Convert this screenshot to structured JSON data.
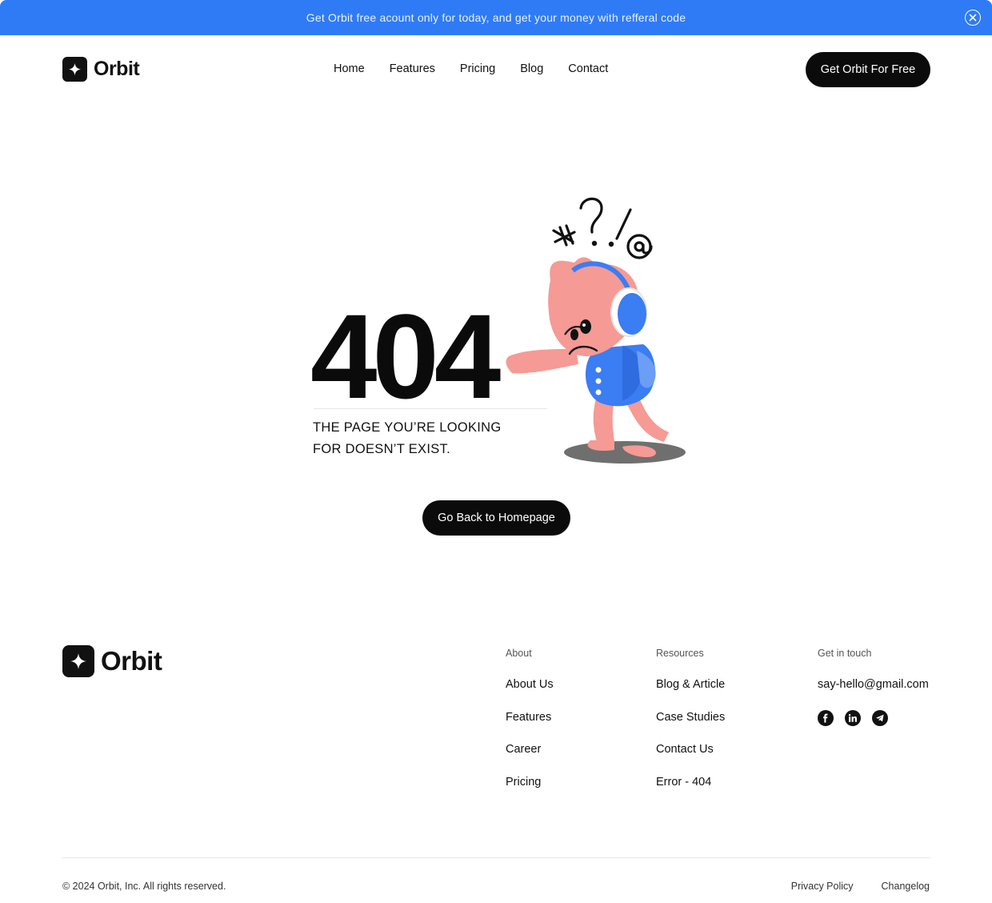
{
  "announcement": {
    "text": "Get Orbit free acount only for today, and get your money with refferal code",
    "close_icon": "close-circle-icon"
  },
  "header": {
    "logo_text": "Orbit",
    "logo_icon": "sparkle-icon",
    "nav": [
      "Home",
      "Features",
      "Pricing",
      "Blog",
      "Contact"
    ],
    "cta": "Get Orbit For Free"
  },
  "error": {
    "code": "404",
    "message_line1": "THE PAGE YOU’RE LOOKING",
    "message_line2": "FOR DOESN’T EXIST.",
    "button": "Go Back to Homepage",
    "illustration": "sad-character-illustration",
    "colors": {
      "character": "#f59a95",
      "headphones": "#3b7df2"
    }
  },
  "footer": {
    "logo_text": "Orbit",
    "about": {
      "heading": "About",
      "links": [
        "About Us",
        "Features",
        "Career",
        "Pricing"
      ]
    },
    "resources": {
      "heading": "Resources",
      "links": [
        "Blog & Article",
        "Case Studies",
        "Contact Us",
        "Error - 404"
      ]
    },
    "touch": {
      "heading": "Get in touch",
      "email": "say-hello@gmail.com",
      "socials": [
        "facebook-icon",
        "linkedin-icon",
        "telegram-icon"
      ]
    },
    "copyright": "© 2024 Orbit, Inc. All rights reserved.",
    "legal": [
      "Privacy Policy",
      "Changelog"
    ]
  },
  "colors": {
    "accent": "#2f7bf6",
    "button": "#0b0b0b",
    "text": "#111111"
  }
}
